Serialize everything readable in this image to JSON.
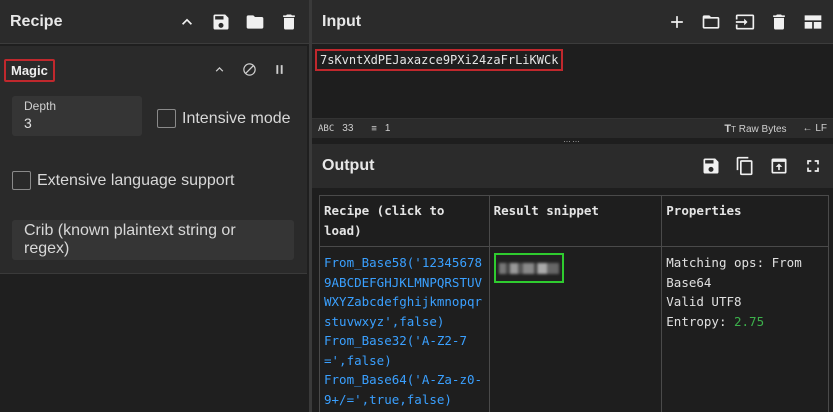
{
  "recipe": {
    "title": "Recipe",
    "icons": [
      "chevron-up-icon",
      "save-icon",
      "folder-icon",
      "trash-icon"
    ],
    "operation": {
      "name": "Magic",
      "controls": [
        "chevron-up-icon",
        "disable-icon",
        "pause-icon"
      ],
      "depth": {
        "label": "Depth",
        "value": "3"
      },
      "intensive_mode": {
        "label": "Intensive mode",
        "checked": false
      },
      "extensive_language": {
        "label": "Extensive language support",
        "checked": false
      },
      "crib": {
        "label": "Crib (known plaintext string or regex)"
      }
    }
  },
  "input": {
    "title": "Input",
    "icons": [
      "plus-icon",
      "folder-icon",
      "import-icon",
      "trash-icon",
      "layout-icon"
    ],
    "text": "7sKvntXdPEJaxazce9PXi24zaFrLiKWCk",
    "status": {
      "chars_label": "ABC",
      "chars": "33",
      "lines": "1",
      "raw_bytes": "Raw Bytes",
      "line_ending": "LF"
    }
  },
  "output": {
    "title": "Output",
    "icons": [
      "save-icon",
      "copy-icon",
      "replace-input-icon",
      "fullscreen-icon"
    ],
    "table": {
      "headers": [
        "Recipe (click to load)",
        "Result snippet",
        "Properties"
      ],
      "recipe_ops": [
        "From_Base58('123456789ABCDEFGHJKLMNPQRSTUVWXYZabcdefghijkmnopqrstuvwxyz',false)",
        "From_Base32('A-Z2-7=',false)",
        "From_Base64('A-Za-z0-9+/=',true,false)"
      ],
      "properties": {
        "matching_ops": "Matching ops: From Base64",
        "valid": "Valid UTF8",
        "entropy_label": "Entropy: ",
        "entropy_value": "2.75"
      }
    }
  },
  "colors": {
    "highlight_red": "#c0282d",
    "highlight_green": "#2fcc2f",
    "link_blue": "#3aa0ff",
    "entropy_green": "#3cb04b"
  }
}
